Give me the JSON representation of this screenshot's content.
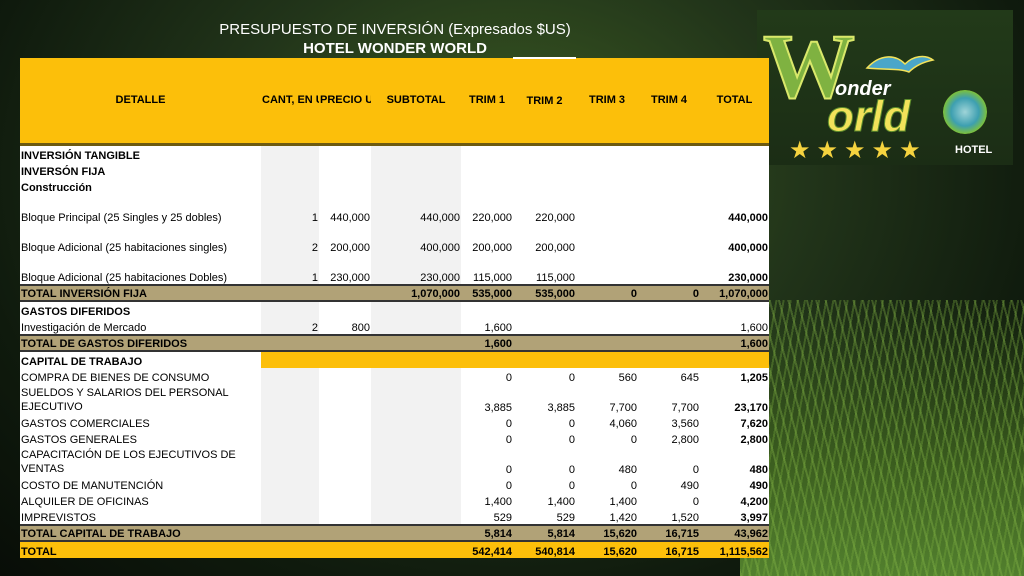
{
  "title": {
    "line1": "PRESUPUESTO DE INVERSIÓN (Expresados $US)",
    "line2": "HOTEL WONDER WORLD"
  },
  "logo": {
    "big_letter": "W",
    "word1": "onder",
    "word2": "orld",
    "stars": "★★★★★",
    "caption": "HOTEL"
  },
  "headers": [
    "DETALLE",
    "CANT, EN UNID.",
    "PRECIO UNIT. BRUTO EN $US",
    "SUBTOTAL",
    "TRIM 1",
    "TRIM 2",
    "TRIM 3",
    "TRIM 4",
    "TOTAL"
  ],
  "rows": [
    {
      "cells": [
        "INVERSIÓN TANGIBLE",
        "",
        "",
        "",
        "",
        "",
        "",
        "",
        ""
      ],
      "style": "section"
    },
    {
      "cells": [
        "INVERSÓN FIJA",
        "",
        "",
        "",
        "",
        "",
        "",
        "",
        ""
      ],
      "style": "section"
    },
    {
      "cells": [
        "Construcción",
        "",
        "",
        "",
        "",
        "",
        "",
        "",
        ""
      ],
      "style": "section"
    },
    {
      "cells": [
        "Bloque Principal (25 Singles y 25 dobles)",
        "1",
        "440,000",
        "440,000",
        "220,000",
        "220,000",
        "",
        "",
        "440,000"
      ],
      "style": "tall"
    },
    {
      "cells": [
        "Bloque Adicional (25 habitaciones singles)",
        "2",
        "200,000",
        "400,000",
        "200,000",
        "200,000",
        "",
        "",
        "400,000"
      ],
      "style": "tall"
    },
    {
      "cells": [
        "Bloque Adicional (25 habitaciones Dobles)",
        "1",
        "230,000",
        "230,000",
        "115,000",
        "115,000",
        "",
        "",
        "230,000"
      ],
      "style": "tall"
    },
    {
      "cells": [
        "TOTAL INVERSIÓN FIJA",
        "",
        "",
        "1,070,000",
        "535,000",
        "535,000",
        "0",
        "0",
        "1,070,000"
      ],
      "style": "total-olive"
    },
    {
      "cells": [
        "GASTOS DIFERIDOS",
        "",
        "",
        "",
        "",
        "",
        "",
        "",
        ""
      ],
      "style": "section"
    },
    {
      "cells": [
        "Investigación de Mercado",
        "2",
        "800",
        "",
        "1,600",
        "",
        "",
        "",
        "1,600"
      ],
      "style": "plain"
    },
    {
      "cells": [
        "TOTAL DE GASTOS DIFERIDOS",
        "",
        "",
        "",
        "1,600",
        "",
        "",
        "",
        "1,600"
      ],
      "style": "total-olive"
    },
    {
      "cells": [
        "CAPITAL DE TRABAJO",
        "",
        "",
        "",
        "",
        "",
        "",
        "",
        ""
      ],
      "style": "section-gold"
    },
    {
      "cells": [
        "COMPRA DE BIENES DE CONSUMO",
        "",
        "",
        "",
        "0",
        "0",
        "560",
        "645",
        "1,205"
      ],
      "style": "plain"
    },
    {
      "cells": [
        "SUELDOS Y SALARIOS DEL PERSONAL EJECUTIVO",
        "",
        "",
        "",
        "3,885",
        "3,885",
        "7,700",
        "7,700",
        "23,170"
      ],
      "style": "tall-wrap"
    },
    {
      "cells": [
        "GASTOS COMERCIALES",
        "",
        "",
        "",
        "0",
        "0",
        "4,060",
        "3,560",
        "7,620"
      ],
      "style": "plain"
    },
    {
      "cells": [
        "GASTOS GENERALES",
        "",
        "",
        "",
        "0",
        "0",
        "0",
        "2,800",
        "2,800"
      ],
      "style": "plain"
    },
    {
      "cells": [
        "CAPACITACIÓN DE LOS EJECUTIVOS DE VENTAS",
        "",
        "",
        "",
        "0",
        "0",
        "480",
        "0",
        "480"
      ],
      "style": "tall-wrap"
    },
    {
      "cells": [
        "COSTO DE MANUTENCIÓN",
        "",
        "",
        "",
        "0",
        "0",
        "0",
        "490",
        "490"
      ],
      "style": "plain"
    },
    {
      "cells": [
        "ALQUILER DE OFICINAS",
        "",
        "",
        "",
        "1,400",
        "1,400",
        "1,400",
        "0",
        "4,200"
      ],
      "style": "plain"
    },
    {
      "cells": [
        "IMPREVISTOS",
        "",
        "",
        "",
        "529",
        "529",
        "1,420",
        "1,520",
        "3,997"
      ],
      "style": "plain"
    },
    {
      "cells": [
        "TOTAL CAPITAL DE TRABAJO",
        "",
        "",
        "",
        "5,814",
        "5,814",
        "15,620",
        "16,715",
        "43,962"
      ],
      "style": "total-olive"
    },
    {
      "cells": [
        "TOTAL",
        "",
        "",
        "",
        "542,414",
        "540,814",
        "15,620",
        "16,715",
        "1,115,562"
      ],
      "style": "total-gold"
    }
  ]
}
